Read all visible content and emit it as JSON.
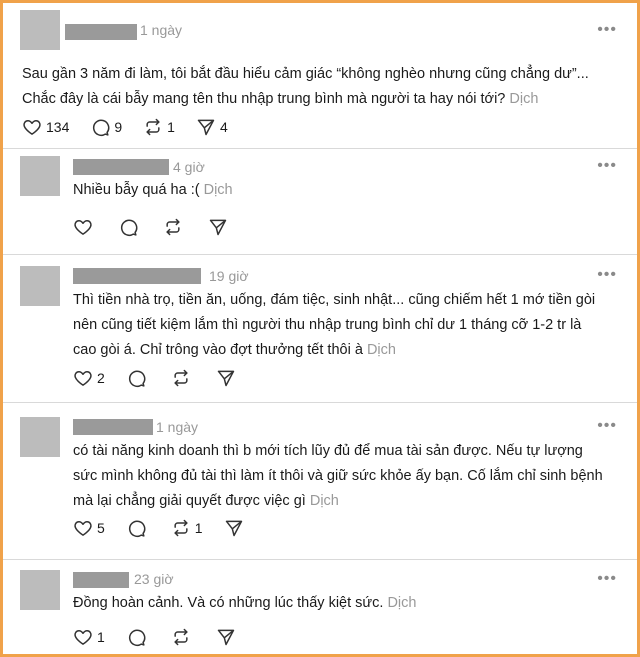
{
  "posts": [
    {
      "time": "1 ngày",
      "lines": [
        "Sau gần 3 năm đi làm, tôi bắt đầu hiểu cảm giác “không nghèo nhưng cũng chẳng dư”...",
        "Chắc đây là cái bẫy mang tên thu nhập trung bình mà người ta hay nói tới?"
      ],
      "translate": "Dịch",
      "likes": "134",
      "comments": "9",
      "reposts": "1",
      "shares": "4"
    },
    {
      "time": "4 giờ",
      "lines": [
        "Nhiều bẫy quá ha :("
      ],
      "translate": "Dịch",
      "likes": "",
      "comments": "",
      "reposts": "",
      "shares": ""
    },
    {
      "time": "19 giờ",
      "lines": [
        "Thì tiền nhà trọ, tiền ăn, uống, đám tiệc, sinh nhật... cũng chiếm hết 1 mớ tiền gòi",
        "nên cũng tiết kiệm lắm thì người thu nhập trung bình chỉ dư 1 tháng cỡ 1-2 tr là",
        "cao gòi á. Chỉ trông vào đợt thưởng tết thôi à"
      ],
      "translate": "Dịch",
      "likes": "2",
      "comments": "",
      "reposts": "",
      "shares": ""
    },
    {
      "time": "1 ngày",
      "lines": [
        "có tài năng kinh doanh thì b mới tích lũy đủ để mua tài sản được. Nếu tự lượng",
        "sức mình không đủ tài thì làm ít thôi và giữ sức khỏe ấy bạn. Cố lắm chỉ sinh bệnh",
        "mà lại chẳng giải quyết được việc gì"
      ],
      "translate": "Dịch",
      "likes": "5",
      "comments": "",
      "reposts": "1",
      "shares": ""
    },
    {
      "time": "23 giờ",
      "lines": [
        "Đồng hoàn cảnh. Và có những lúc thấy kiệt sức."
      ],
      "translate": "Dịch",
      "likes": "1",
      "comments": "",
      "reposts": "",
      "shares": ""
    }
  ],
  "icons": {
    "more": "more-horizontal-icon",
    "like": "heart-icon",
    "comment": "comment-icon",
    "repost": "repost-icon",
    "share": "send-icon"
  },
  "colors": {
    "border": "#f0a24a",
    "muted": "#999999",
    "text": "#1a1a1a"
  }
}
